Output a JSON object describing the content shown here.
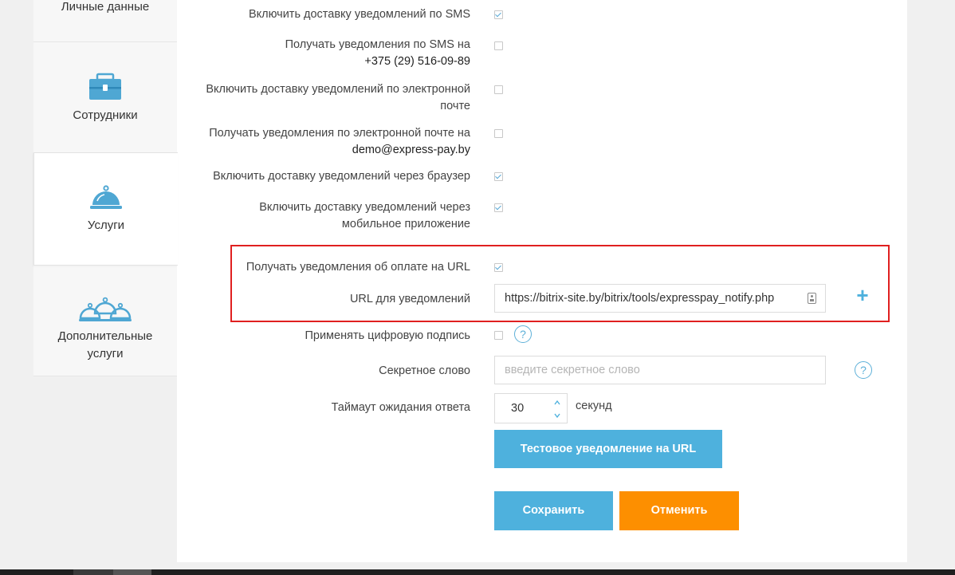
{
  "sidebar": {
    "items": [
      {
        "label": "Личные данные",
        "icon": "user-icon"
      },
      {
        "label": "Сотрудники",
        "icon": "briefcase-icon"
      },
      {
        "label": "Услуги",
        "icon": "cloche-icon",
        "active": true
      },
      {
        "label_line1": "Дополнительные",
        "label_line2": "услуги",
        "icon": "cloches-icon"
      }
    ]
  },
  "settings": {
    "sms_enable": {
      "label": "Включить доставку уведомлений по SMS",
      "checked": true
    },
    "sms_receive": {
      "label": "Получать уведомления по SMS на",
      "phone": "+375 (29) 516-09-89",
      "checked": false
    },
    "email_enable": {
      "label_line1": "Включить доставку уведомлений по электронной",
      "label_line2": "почте",
      "checked": false
    },
    "email_receive": {
      "label": "Получать уведомления по электронной почте на",
      "email": "demo@express-pay.by",
      "checked": false
    },
    "browser_enable": {
      "label": "Включить доставку уведомлений через браузер",
      "checked": true
    },
    "mobile_enable": {
      "label_line1": "Включить доставку уведомлений через",
      "label_line2": "мобильное приложение",
      "checked": true
    },
    "url_payment": {
      "label": "Получать уведомления об оплате на URL",
      "checked": true
    },
    "url_field": {
      "label": "URL для уведомлений",
      "value": "https://bitrix-site.by/bitrix/tools/expresspay_notify.php"
    },
    "digital_signature": {
      "label": "Применять цифровую подпись",
      "checked": false,
      "help": "?"
    },
    "secret_word": {
      "label": "Секретное слово",
      "placeholder": "введите секретное слово",
      "help": "?"
    },
    "timeout": {
      "label": "Таймаут ожидания ответа",
      "value": "30",
      "unit": "секунд"
    }
  },
  "buttons": {
    "test_notification": "Тестовое уведомление на URL",
    "save": "Сохранить",
    "cancel": "Отменить",
    "add": "+"
  },
  "colors": {
    "accent_blue": "#4eb1dd",
    "cancel_orange": "#fd8f00",
    "highlight_red": "#e02020"
  }
}
